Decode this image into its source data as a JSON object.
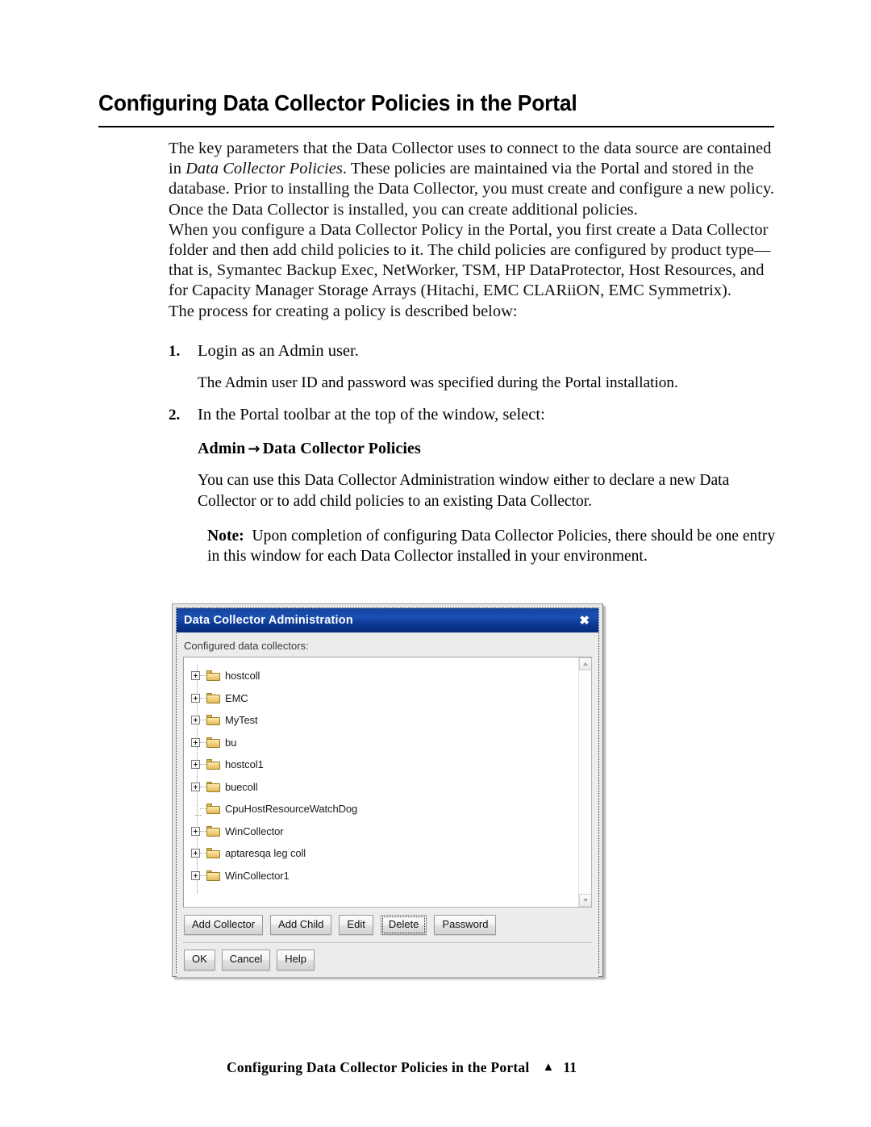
{
  "page": {
    "heading": "Configuring Data Collector Policies in the Portal",
    "paragraph_1_part_a": "The key parameters that the Data Collector uses to connect to the data source are contained in ",
    "paragraph_1_italic": "Data Collector Policies",
    "paragraph_1_part_b": ". These policies are maintained via the Portal and stored in the database. Prior to installing the Data Collector, you must create and configure a new policy. Once the Data Collector is installed, you can create additional policies.",
    "paragraph_2": "When you configure a Data Collector Policy in the Portal, you first create a Data Collector folder and then add child policies to it. The child policies are configured by product type—that is, Symantec Backup Exec, NetWorker, TSM, HP DataProtector, Host Resources, and for Capacity Manager Storage Arrays (Hitachi, EMC CLARiiON, EMC Symmetrix).",
    "paragraph_3": "The process for creating a policy is described below:",
    "steps": [
      {
        "number": "1.",
        "text": "Login as an Admin user."
      },
      {
        "number": "2.",
        "text": "In the Portal toolbar at the top of the window, select:"
      }
    ],
    "step_1_detail": "The Admin user ID and password was specified during the Portal installation.",
    "admin_path": {
      "first": "Admin",
      "arrow": "→",
      "second": "Data Collector Policies"
    },
    "step_2_detail": "You can use this Data Collector Administration window either to declare a new Data Collector or to add child policies to an existing Data Collector.",
    "note": {
      "lead": "Note:",
      "body": "Upon completion of configuring Data Collector Policies, there should be one entry in this window for each Data Collector installed in your environment."
    }
  },
  "dialog": {
    "title": "Data Collector Administration",
    "close_label": "✖",
    "field_label": "Configured data collectors:",
    "tree_items": [
      {
        "label": "hostcoll",
        "expandable": true
      },
      {
        "label": "EMC",
        "expandable": true
      },
      {
        "label": "MyTest",
        "expandable": true
      },
      {
        "label": "bu",
        "expandable": true
      },
      {
        "label": "hostcol1",
        "expandable": true
      },
      {
        "label": "buecoll",
        "expandable": true
      },
      {
        "label": "CpuHostResourceWatchDog",
        "expandable": false
      },
      {
        "label": "WinCollector",
        "expandable": true
      },
      {
        "label": "aptaresqa leg coll",
        "expandable": true
      },
      {
        "label": "WinCollector1",
        "expandable": true
      }
    ],
    "action_buttons": [
      {
        "label": "Add Collector",
        "focused": false
      },
      {
        "label": "Add Child",
        "focused": false
      },
      {
        "label": "Edit",
        "focused": false
      },
      {
        "label": "Delete",
        "focused": true
      },
      {
        "label": "Password",
        "focused": false
      }
    ],
    "dialog_buttons": [
      {
        "label": "OK"
      },
      {
        "label": "Cancel"
      },
      {
        "label": "Help"
      }
    ],
    "colors": {
      "titlebar_blue": "#17459e",
      "folder_gold": "#f3d484"
    }
  },
  "footer": {
    "title": "Configuring Data Collector Policies in the Portal",
    "triangle": "▲",
    "page_number": "11"
  }
}
